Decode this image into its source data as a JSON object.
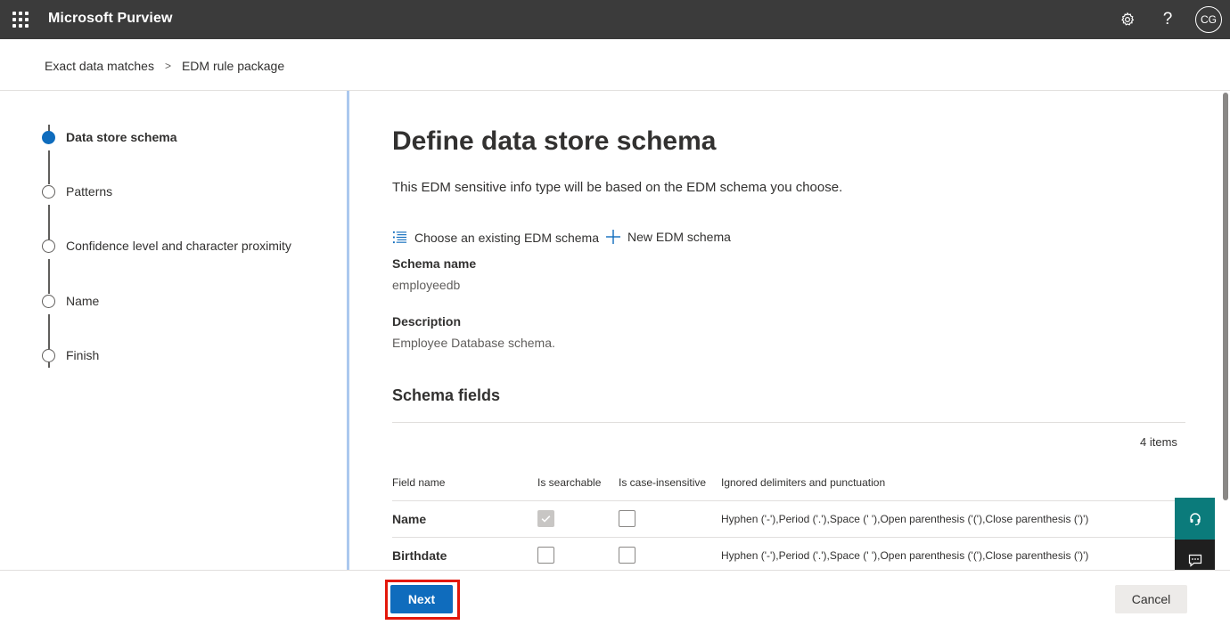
{
  "app": {
    "title": "Microsoft Purview",
    "avatar_initials": "CG"
  },
  "topbar": {
    "icons": [
      "waffle-icon",
      "settings-icon",
      "help-icon"
    ],
    "help_glyph": "?"
  },
  "breadcrumb": {
    "items": [
      "Exact data matches",
      "EDM rule package"
    ],
    "separator": ">"
  },
  "steps": [
    {
      "label": "Data store schema",
      "active": true
    },
    {
      "label": "Patterns",
      "active": false
    },
    {
      "label": "Confidence level and character proximity",
      "active": false
    },
    {
      "label": "Name",
      "active": false
    },
    {
      "label": "Finish",
      "active": false
    }
  ],
  "main": {
    "title": "Define data store schema",
    "subtitle": "This EDM sensitive info type will be based on the EDM schema you choose.",
    "actions": {
      "choose_existing": "Choose an existing EDM schema",
      "new_schema": "New EDM schema"
    },
    "schema_name_label": "Schema name",
    "schema_name_value": "employeedb",
    "description_label": "Description",
    "description_value": "Employee Database schema.",
    "section_title": "Schema fields",
    "items_count": "4 items",
    "table": {
      "headers": [
        "Field name",
        "Is searchable",
        "Is case-insensitive",
        "Ignored delimiters and punctuation"
      ],
      "rows": [
        {
          "field": "Name",
          "searchable": true,
          "searchable_disabled": true,
          "case_insensitive": false,
          "delimiters": "Hyphen ('-'),Period ('.'),Space (' '),Open parenthesis ('('),Close parenthesis (')')"
        },
        {
          "field": "Birthdate",
          "searchable": false,
          "searchable_disabled": false,
          "case_insensitive": false,
          "delimiters": "Hyphen ('-'),Period ('.'),Space (' '),Open parenthesis ('('),Close parenthesis (')')"
        }
      ]
    }
  },
  "footer": {
    "next_label": "Next",
    "cancel_label": "Cancel"
  },
  "colors": {
    "topbar": "#3b3b3b",
    "accent": "#0f6cbd",
    "highlight": "#e3170a",
    "support": "#0b7b7b",
    "feedback": "#1f1f1f"
  }
}
